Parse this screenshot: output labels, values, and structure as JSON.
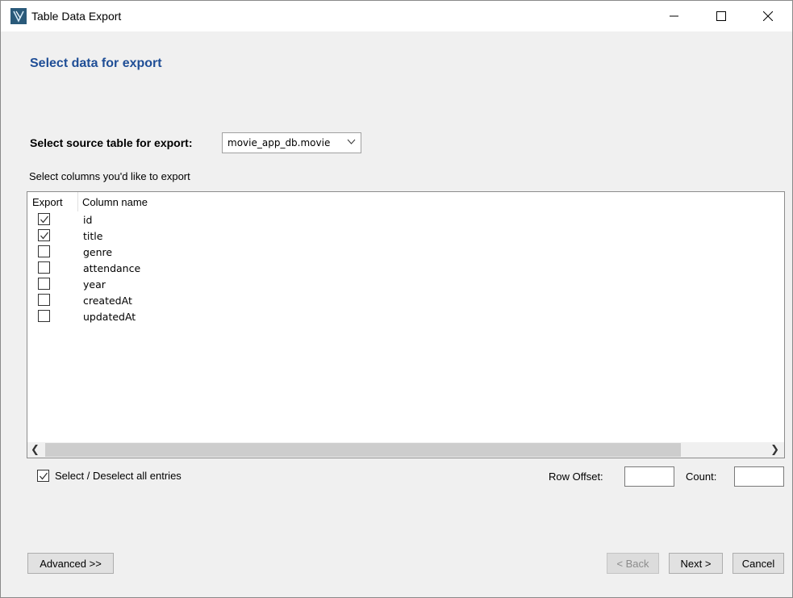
{
  "window": {
    "title": "Table Data Export",
    "icon": "mysql-workbench-icon",
    "controls": [
      "minimize-icon",
      "maximize-icon",
      "close-icon"
    ]
  },
  "page": {
    "title": "Select data for export"
  },
  "source": {
    "label": "Select source table for export:",
    "selected": "movie_app_db.movie"
  },
  "columns": {
    "label": "Select columns you'd like to export",
    "headers": {
      "export": "Export",
      "name": "Column name"
    },
    "rows": [
      {
        "name": "id",
        "checked": true
      },
      {
        "name": "title",
        "checked": true
      },
      {
        "name": "genre",
        "checked": false
      },
      {
        "name": "attendance",
        "checked": false
      },
      {
        "name": "year",
        "checked": false
      },
      {
        "name": "createdAt",
        "checked": false
      },
      {
        "name": "updatedAt",
        "checked": false
      }
    ]
  },
  "select_all": {
    "label": "Select / Deselect all entries",
    "checked": true
  },
  "row_offset": {
    "label": "Row Offset:",
    "value": ""
  },
  "count": {
    "label": "Count:",
    "value": ""
  },
  "buttons": {
    "advanced": "Advanced >>",
    "back": "< Back",
    "next": "Next >",
    "cancel": "Cancel"
  },
  "colors": {
    "title_blue": "#1f4e96",
    "titlebar_bg": "#ffffff",
    "dialog_bg": "#f0f0f0"
  }
}
